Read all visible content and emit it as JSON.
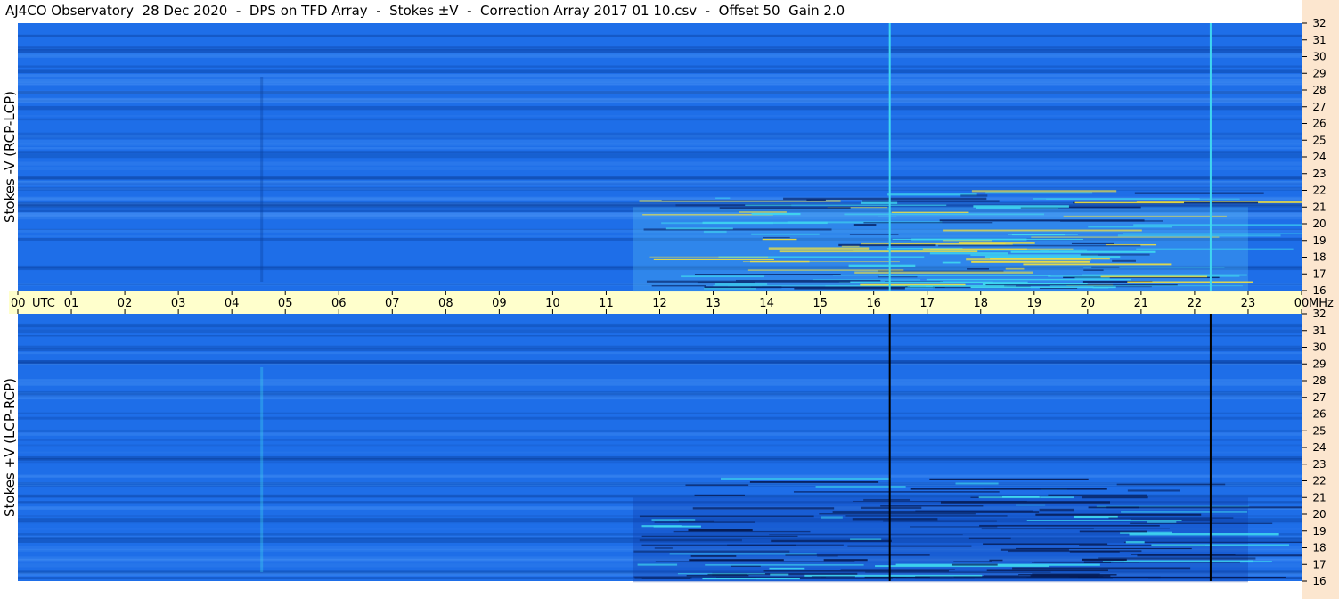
{
  "title": "AJ4CO Observatory  28 Dec 2020  -  DPS on TFD Array  -  Stokes ±V  -  Correction Array 2017 01 10.csv  -  Offset 50  Gain 2.0",
  "colors": {
    "background_blue": "#1e6ee8",
    "dark_blue": "#0a3f9c",
    "cyan": "#3fd7f0",
    "yellow": "#f0e040",
    "axis_band": "#ffffcc",
    "freq_strip": "#fce6cf"
  },
  "chart_data": [
    {
      "type": "heatmap",
      "name": "Stokes -V (RCP-LCP)",
      "ylabel": "Stokes -V (RCP-LCP)",
      "x_unit": "UTC",
      "xlim": [
        0,
        24
      ],
      "y_unit": "MHz",
      "ylim": [
        16,
        32
      ],
      "y_ticks": [
        "16",
        "17",
        "18",
        "19",
        "20",
        "21",
        "22",
        "23",
        "24",
        "25",
        "26",
        "27",
        "28",
        "29",
        "30",
        "31",
        "32"
      ],
      "vertical_lines_utc": [
        16.3,
        22.3
      ],
      "vertical_line_color": "cyan",
      "activity_region_utc": [
        11.5,
        23
      ]
    },
    {
      "type": "heatmap",
      "name": "Stokes +V (LCP-RCP)",
      "ylabel": "Stokes +V (LCP-RCP)",
      "x_unit": "UTC",
      "xlim": [
        0,
        24
      ],
      "y_unit": "MHz",
      "ylim": [
        16,
        32
      ],
      "y_ticks": [
        "16",
        "17",
        "18",
        "19",
        "20",
        "21",
        "22",
        "23",
        "24",
        "25",
        "26",
        "27",
        "28",
        "29",
        "30",
        "31",
        "32"
      ],
      "vertical_lines_utc": [
        16.3,
        22.3
      ],
      "vertical_line_color": "dark",
      "activity_region_utc": [
        11.5,
        23
      ]
    }
  ],
  "time_axis": {
    "ticks": [
      "00",
      "01",
      "02",
      "03",
      "04",
      "05",
      "06",
      "07",
      "08",
      "09",
      "10",
      "11",
      "12",
      "13",
      "14",
      "15",
      "16",
      "17",
      "18",
      "19",
      "20",
      "21",
      "22",
      "23",
      "00"
    ],
    "utc_label": "UTC",
    "mhz_label": "MHz"
  }
}
